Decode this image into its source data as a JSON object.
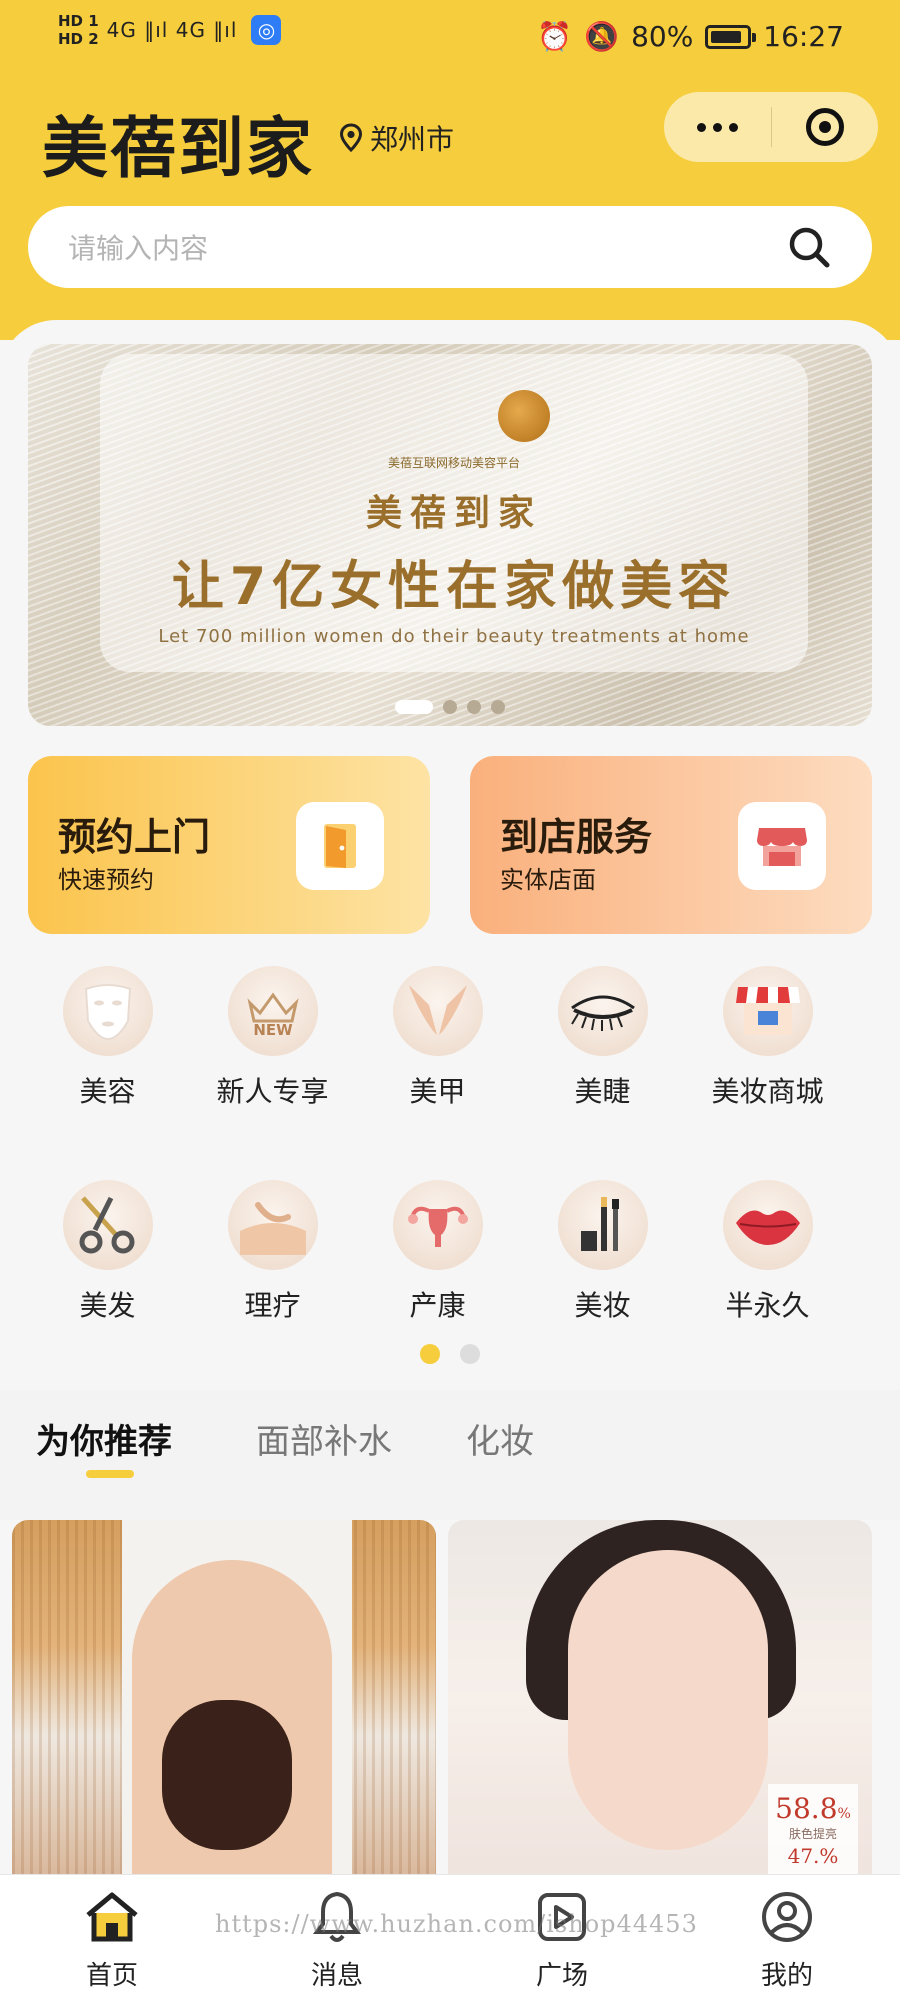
{
  "status_bar": {
    "hd1": "HD 1",
    "hd2": "HD 2",
    "signal": "4G ‖ıl 4G ‖ıl",
    "battery_text": "80%",
    "time": "16:27"
  },
  "header": {
    "app_title": "美蓓到家",
    "city": "郑州市"
  },
  "search": {
    "placeholder": "请输入内容"
  },
  "banner": {
    "sub_title": "美蓓互联网移动美容平台",
    "name": "美蓓到家",
    "slogan": "让7亿女性在家做美容",
    "slogan_en": "Let 700 million women do their beauty treatments at home",
    "slides": 4,
    "active_slide": 1
  },
  "services": [
    {
      "title": "预约上门",
      "sub": "快速预约",
      "icon": "door-icon"
    },
    {
      "title": "到店服务",
      "sub": "实体店面",
      "icon": "store-icon"
    }
  ],
  "categories": [
    {
      "label": "美容",
      "icon": "face-mask-icon"
    },
    {
      "label": "新人专享",
      "icon": "new-crown-icon"
    },
    {
      "label": "美甲",
      "icon": "nail-hands-icon"
    },
    {
      "label": "美睫",
      "icon": "eyelash-icon"
    },
    {
      "label": "美妆商城",
      "icon": "shop-icon"
    },
    {
      "label": "美发",
      "icon": "scissors-icon"
    },
    {
      "label": "理疗",
      "icon": "massage-icon"
    },
    {
      "label": "产康",
      "icon": "uterus-icon"
    },
    {
      "label": "美妆",
      "icon": "makeup-brush-icon"
    },
    {
      "label": "半永久",
      "icon": "lips-icon"
    }
  ],
  "category_pages": {
    "count": 2,
    "active": 1
  },
  "tabs": [
    {
      "label": "为你推荐",
      "active": true
    },
    {
      "label": "面部补水",
      "active": false
    },
    {
      "label": "化妆",
      "active": false
    }
  ],
  "cards": [
    {
      "kind": "back massage photo"
    },
    {
      "kind": "facial care photo",
      "stat_value": "58.8",
      "stat_unit": "%",
      "stat_label": "肤色提亮",
      "stat_value2": "47.%"
    }
  ],
  "bottom_nav": [
    {
      "label": "首页",
      "icon": "home-icon",
      "active": true
    },
    {
      "label": "消息",
      "icon": "bell-icon",
      "active": false
    },
    {
      "label": "广场",
      "icon": "play-square-icon",
      "active": false
    },
    {
      "label": "我的",
      "icon": "user-icon",
      "active": false
    }
  ],
  "watermark": "https://www.huzhan.com/ishop44453",
  "colors": {
    "brand_yellow": "#f6cd3c",
    "capsule_bg": "#fbe9a9",
    "gold_text": "#9a6f2b"
  }
}
